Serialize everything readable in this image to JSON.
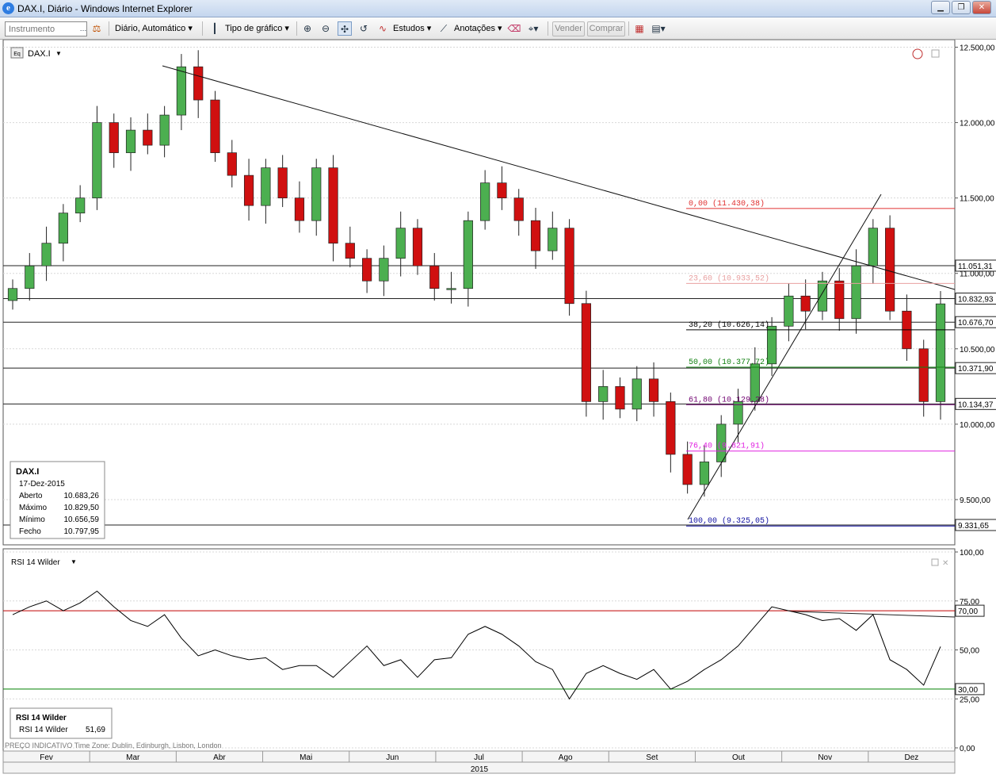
{
  "window": {
    "title": "DAX.I, Diário - Windows Internet Explorer"
  },
  "toolbar": {
    "instrument_placeholder": "Instrumento",
    "period_label": "Diário,  Automático",
    "chart_type_label": "Tipo de gráfico",
    "studies_label": "Estudos",
    "annotations_label": "Anotações",
    "sell_label": "Vender",
    "buy_label": "Comprar"
  },
  "main": {
    "symbol": "DAX.I",
    "info": {
      "title": "DAX.I",
      "date": "17-Dez-2015",
      "rows": [
        {
          "label": "Aberto",
          "value": "10.683,26"
        },
        {
          "label": "Máximo",
          "value": "10.829,50"
        },
        {
          "label": "Mínimo",
          "value": "10.656,59"
        },
        {
          "label": "Fecho",
          "value": "10.797,95"
        }
      ]
    },
    "price_ticks": [
      "12.500,00",
      "12.000,00",
      "11.500,00",
      "11.000,00",
      "10.500,00",
      "10.000,00",
      "9.500,00"
    ],
    "price_tags": [
      {
        "text": "11.051,31",
        "value": 11051.31
      },
      {
        "text": "10.832,93",
        "value": 10832.93
      },
      {
        "text": "10.676,70",
        "value": 10676.7
      },
      {
        "text": "10.371,90",
        "value": 10371.9
      },
      {
        "text": "10.134,37",
        "value": 10134.37
      },
      {
        "text": "9.331,65",
        "value": 9331.65
      }
    ],
    "fib_levels": [
      {
        "text": "0,00 (11.430,38)",
        "value": 11430.38,
        "color": "#e03030"
      },
      {
        "text": "23,60 (10.933,52)",
        "value": 10933.52,
        "color": "#e8a0a0"
      },
      {
        "text": "38,20 (10.626,14)",
        "value": 10626.14,
        "color": "#000000"
      },
      {
        "text": "50,00 (10.377,72)",
        "value": 10377.72,
        "color": "#108010"
      },
      {
        "text": "61,80 (10.129,28)",
        "value": 10129.28,
        "color": "#700070"
      },
      {
        "text": "76,40 (9.821,91)",
        "value": 9821.91,
        "color": "#e020e0"
      },
      {
        "text": "100,00 (9.325,05)",
        "value": 9325.05,
        "color": "#1010a0"
      }
    ]
  },
  "rsi": {
    "label": "RSI 14 Wilder",
    "info_title": "RSI 14 Wilder",
    "info_row": {
      "label": "RSI 14 Wilder",
      "value": "51,69"
    },
    "ticks": [
      "100,00",
      "75,00",
      "50,00",
      "25,00",
      "0,00"
    ],
    "tags": [
      {
        "text": "70,00",
        "value": 70
      },
      {
        "text": "30,00",
        "value": 30
      }
    ]
  },
  "footer": {
    "note": "PREÇO INDICATIVO    Time Zone: Dublin, Edinburgh, Lisbon, London",
    "months": [
      "Fev",
      "Mar",
      "Abr",
      "Mai",
      "Jun",
      "Jul",
      "Ago",
      "Set",
      "Out",
      "Nov",
      "Dez"
    ],
    "year": "2015"
  },
  "colors": {
    "up": "#4caf50",
    "down": "#d01010",
    "grid": "#d8d8d8",
    "upper_band": "#c00000",
    "lower_band": "#008000"
  },
  "chart_data": {
    "type": "candlestick",
    "x": [
      "12-Fev",
      "18-Fev",
      "24-Fev",
      "02-Mar",
      "06-Mar",
      "12-Mar",
      "18-Mar",
      "24-Mar",
      "30-Mar",
      "06-Abr",
      "10-Abr",
      "16-Abr",
      "22-Abr",
      "28-Abr",
      "04-Mai",
      "08-Mai",
      "14-Mai",
      "20-Mai",
      "26-Mai",
      "01-Jun",
      "05-Jun",
      "11-Jun",
      "17-Jun",
      "23-Jun",
      "29-Jun",
      "03-Jul",
      "09-Jul",
      "15-Jul",
      "21-Jul",
      "27-Jul",
      "31-Jul",
      "06-Ago",
      "12-Ago",
      "18-Ago",
      "24-Ago",
      "28-Ago",
      "03-Set",
      "09-Set",
      "15-Set",
      "21-Set",
      "25-Set",
      "01-Out",
      "07-Out",
      "13-Out",
      "19-Out",
      "23-Out",
      "29-Out",
      "04-Nov",
      "10-Nov",
      "16-Nov",
      "20-Nov",
      "26-Nov",
      "02-Dez",
      "08-Dez",
      "14-Dez",
      "17-Dez"
    ],
    "close": [
      10900,
      11050,
      11200,
      11400,
      11500,
      12000,
      11800,
      11950,
      11850,
      12050,
      12370,
      12150,
      11800,
      11650,
      11450,
      11700,
      11500,
      11350,
      11700,
      11200,
      11100,
      10950,
      11100,
      11300,
      11050,
      10900,
      10900,
      11350,
      11600,
      11500,
      11350,
      11150,
      11300,
      10800,
      10150,
      10250,
      10100,
      10300,
      10150,
      9800,
      9600,
      9750,
      10000,
      10150,
      10400,
      10650,
      10850,
      10750,
      10950,
      10700,
      11050,
      11300,
      10750,
      10500,
      10150,
      10797.95
    ],
    "ylim": [
      9200,
      12550
    ],
    "rsi": {
      "name": "RSI 14 Wilder",
      "values": [
        68,
        72,
        75,
        70,
        74,
        80,
        72,
        65,
        62,
        68,
        56,
        47,
        50,
        47,
        45,
        46,
        40,
        42,
        42,
        36,
        44,
        52,
        42,
        45,
        36,
        45,
        46,
        58,
        62,
        58,
        52,
        44,
        40,
        25,
        38,
        42,
        38,
        35,
        40,
        30,
        34,
        40,
        45,
        52,
        62,
        72,
        70,
        68,
        65,
        66,
        60,
        68,
        45,
        40,
        32,
        51.69
      ],
      "upper": 70,
      "lower": 30,
      "ylim": [
        0,
        100
      ]
    }
  }
}
